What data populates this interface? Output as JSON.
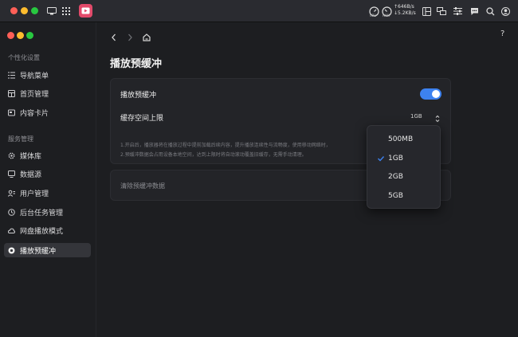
{
  "menubar": {
    "net_up": "↑646B/s",
    "net_down": "↓5.2KB/s",
    "cpu_label": "CPU",
    "ram_label": "RAM",
    "traffic_light_colors": [
      "#ff5f57",
      "#febc2e",
      "#28c840"
    ]
  },
  "sidebar": {
    "section1_title": "个性化设置",
    "section1_items": [
      {
        "label": "导航菜单",
        "icon": "menu-list-icon"
      },
      {
        "label": "首页管理",
        "icon": "home-grid-icon"
      },
      {
        "label": "内容卡片",
        "icon": "card-icon"
      }
    ],
    "section2_title": "服务管理",
    "section2_items": [
      {
        "label": "媒体库",
        "icon": "gear-icon"
      },
      {
        "label": "数据源",
        "icon": "monitor-icon"
      },
      {
        "label": "用户管理",
        "icon": "users-icon"
      },
      {
        "label": "后台任务管理",
        "icon": "clock-icon"
      },
      {
        "label": "网盘播放模式",
        "icon": "cloud-icon"
      },
      {
        "label": "播放预缓冲",
        "icon": "record-icon",
        "active": true
      }
    ]
  },
  "header": {
    "help": "?"
  },
  "page": {
    "title": "播放预缓冲",
    "toggle_label": "播放预缓冲",
    "toggle_on": true,
    "cache_label": "缓存空间上限",
    "cache_value": "1GB",
    "note1": "1.开启后，播放器将在播放过程中提前加载后续内容，提升播放连续性与流畅度，使用移动网络时，",
    "note2": "2.预缓冲数据会占用设备本地空间，达到上限时将自动滚动覆盖旧缓存，无需手动清理。",
    "clear_label": "清除预缓冲数据"
  },
  "dropdown": {
    "options": [
      "500MB",
      "1GB",
      "2GB",
      "5GB"
    ],
    "selected": "1GB"
  },
  "colors": {
    "accent": "#3d82f0"
  }
}
